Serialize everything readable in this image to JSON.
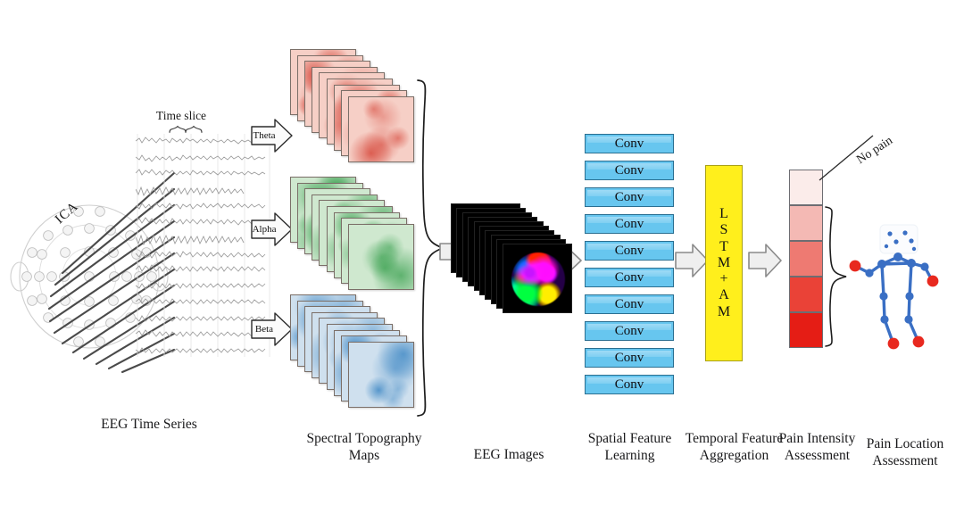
{
  "figure": {
    "title": "EEG-based pain assessment pipeline",
    "background": "#ffffff"
  },
  "annotations": {
    "ica": "ICA",
    "time_slice": "Time slice",
    "no_pain": "No pain"
  },
  "bands": [
    {
      "name": "Theta",
      "color": "#d6473a",
      "tile_fill": "#f6cfc6",
      "count": 9
    },
    {
      "name": "Alpha",
      "color": "#2e9b45",
      "tile_fill": "#cfe8cf",
      "count": 9
    },
    {
      "name": "Beta",
      "color": "#3d87c4",
      "tile_fill": "#cfe0ee",
      "count": 9
    }
  ],
  "eeg_images": {
    "count": 10,
    "background": "#000000"
  },
  "conv": {
    "label": "Conv",
    "count": 10,
    "fill": "#67c6ef",
    "border": "#2b6f91"
  },
  "lstm": {
    "letters": [
      "L",
      "S",
      "T",
      "M",
      "+",
      "A",
      "M"
    ],
    "fill": "#ffef1c",
    "border": "#a9a016"
  },
  "pain_scale": {
    "segments": [
      {
        "level": 0,
        "color": "#fbecea"
      },
      {
        "level": 1,
        "color": "#f4b9b4"
      },
      {
        "level": 2,
        "color": "#ee7a72"
      },
      {
        "level": 3,
        "color": "#ea4237"
      },
      {
        "level": 4,
        "color": "#e51d15"
      }
    ]
  },
  "skeleton": {
    "joint_color": "#3a6fc4",
    "endpoint_color": "#e8291f",
    "limb_color": "#3a6fc4"
  },
  "captions": [
    {
      "id": "eeg-time-series",
      "text": "EEG Time Series"
    },
    {
      "id": "spectral-topography",
      "text": "Spectral Topography\nMaps"
    },
    {
      "id": "eeg-images",
      "text": "EEG Images"
    },
    {
      "id": "spatial-feature",
      "text": "Spatial Feature\nLearning"
    },
    {
      "id": "temporal-feature",
      "text": "Temporal Feature\nAggregation"
    },
    {
      "id": "pain-intensity",
      "text": "Pain Intensity\nAssessment"
    },
    {
      "id": "pain-location",
      "text": "Pain Location\nAssessment"
    }
  ]
}
